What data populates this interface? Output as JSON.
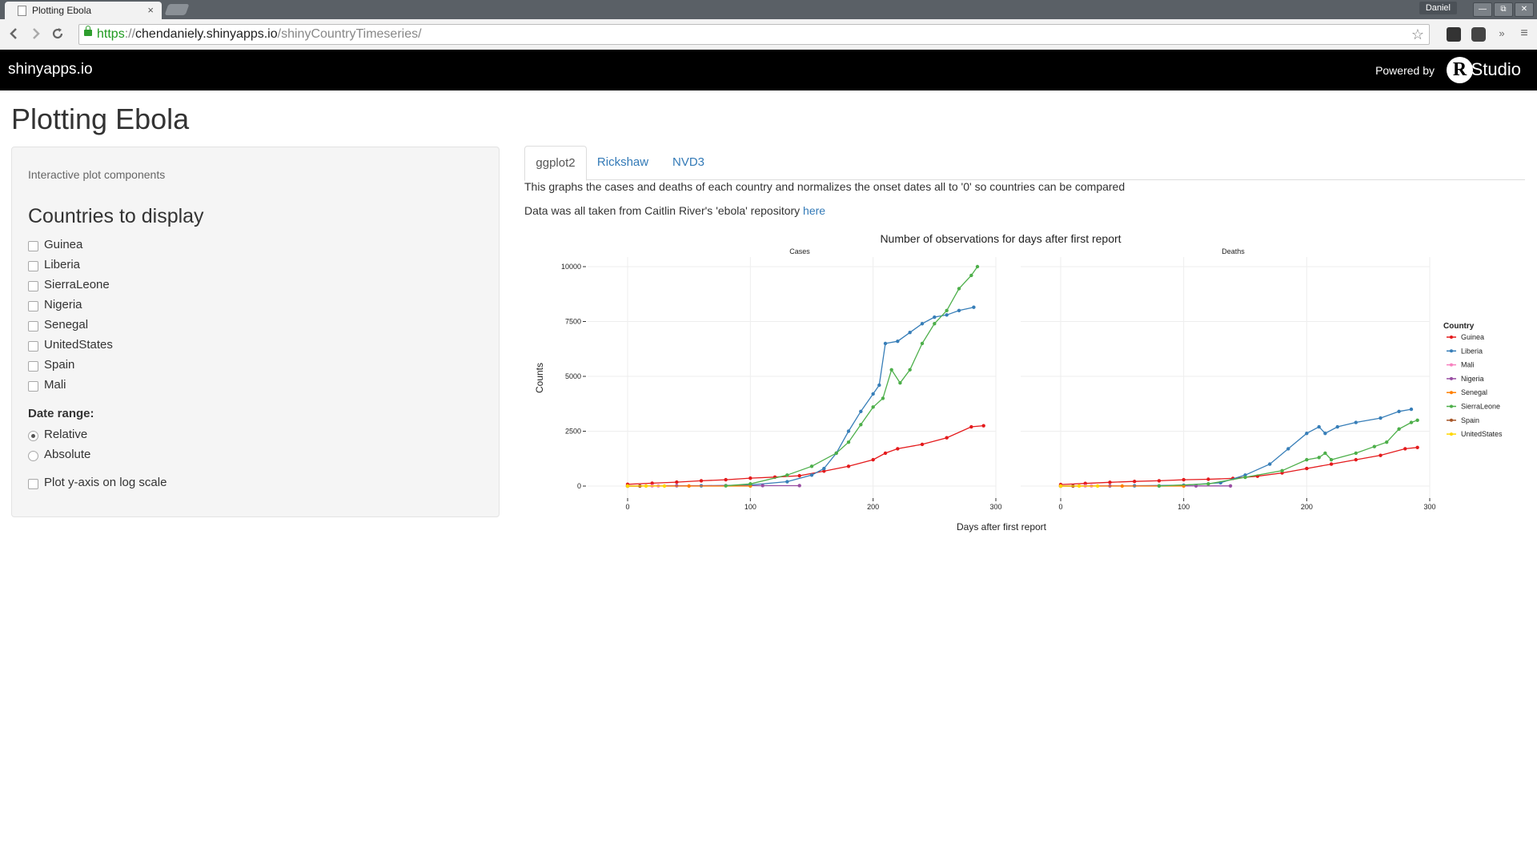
{
  "browser": {
    "tab_title": "Plotting Ebola",
    "tab_close": "×",
    "user": "Daniel",
    "url_scheme": "https",
    "url_sep": "://",
    "url_host": "chendaniely.shinyapps.io",
    "url_path": "/shinyCountryTimeseries/",
    "win_min": "—",
    "win_max": "⧉",
    "win_close": "✕"
  },
  "navbar": {
    "brand": "shinyapps.io",
    "powered_by": "Powered by",
    "rstudio_r": "R",
    "rstudio_text": "Studio"
  },
  "page": {
    "title": "Plotting Ebola"
  },
  "sidebar": {
    "caption": "Interactive plot components",
    "heading": "Countries to display",
    "countries": [
      {
        "label": "Guinea",
        "checked": false
      },
      {
        "label": "Liberia",
        "checked": false
      },
      {
        "label": "SierraLeone",
        "checked": false
      },
      {
        "label": "Nigeria",
        "checked": false
      },
      {
        "label": "Senegal",
        "checked": false
      },
      {
        "label": "UnitedStates",
        "checked": false
      },
      {
        "label": "Spain",
        "checked": false
      },
      {
        "label": "Mali",
        "checked": false
      }
    ],
    "date_range_label": "Date range:",
    "date_options": [
      {
        "label": "Relative",
        "selected": true
      },
      {
        "label": "Absolute",
        "selected": false
      }
    ],
    "log_scale_label": "Plot y-axis on log scale"
  },
  "tabs": [
    {
      "label": "ggplot2",
      "active": true
    },
    {
      "label": "Rickshaw",
      "active": false
    },
    {
      "label": "NVD3",
      "active": false
    }
  ],
  "description": {
    "line1": "This graphs the cases and deaths of each country and normalizes the onset dates all to '0' so countries can be compared",
    "line2_prefix": "Data was all taken from Caitlin River's 'ebola' repository",
    "line2_link": "here"
  },
  "chart_data": {
    "type": "line",
    "title": "Number of observations for days after first report",
    "xlabel": "Days after first report",
    "ylabel": "Counts",
    "xlim": [
      0,
      300
    ],
    "ylim": [
      0,
      10000
    ],
    "x_ticks": [
      0,
      100,
      200,
      300
    ],
    "y_ticks": [
      0,
      2500,
      5000,
      7500,
      10000
    ],
    "y_tick_labels": [
      "0",
      "2500",
      "5000",
      "7500",
      "10000"
    ],
    "grid": true,
    "legend_title": "Country",
    "legend_position": "right",
    "facets": [
      {
        "name": "Cases",
        "series": [
          {
            "name": "Guinea",
            "color": "#e41a1c",
            "points": [
              [
                0,
                80
              ],
              [
                20,
                130
              ],
              [
                40,
                180
              ],
              [
                60,
                240
              ],
              [
                80,
                290
              ],
              [
                100,
                360
              ],
              [
                120,
                410
              ],
              [
                140,
                470
              ],
              [
                160,
                680
              ],
              [
                180,
                900
              ],
              [
                200,
                1200
              ],
              [
                210,
                1500
              ],
              [
                220,
                1700
              ],
              [
                240,
                1900
              ],
              [
                260,
                2200
              ],
              [
                280,
                2700
              ],
              [
                290,
                2750
              ]
            ]
          },
          {
            "name": "Liberia",
            "color": "#377eb8",
            "points": [
              [
                60,
                10
              ],
              [
                100,
                50
              ],
              [
                130,
                200
              ],
              [
                150,
                500
              ],
              [
                160,
                800
              ],
              [
                170,
                1500
              ],
              [
                180,
                2500
              ],
              [
                190,
                3400
              ],
              [
                200,
                4200
              ],
              [
                205,
                4600
              ],
              [
                210,
                6500
              ],
              [
                220,
                6600
              ],
              [
                230,
                7000
              ],
              [
                240,
                7400
              ],
              [
                250,
                7700
              ],
              [
                260,
                7800
              ],
              [
                270,
                8000
              ],
              [
                282,
                8150
              ]
            ]
          },
          {
            "name": "Mali",
            "color": "#f781bf",
            "points": [
              [
                0,
                1
              ],
              [
                10,
                3
              ],
              [
                20,
                6
              ],
              [
                25,
                8
              ]
            ]
          },
          {
            "name": "Nigeria",
            "color": "#984ea3",
            "points": [
              [
                0,
                0
              ],
              [
                40,
                15
              ],
              [
                80,
                20
              ],
              [
                110,
                20
              ],
              [
                140,
                20
              ]
            ]
          },
          {
            "name": "Senegal",
            "color": "#ff7f00",
            "points": [
              [
                0,
                1
              ],
              [
                50,
                1
              ],
              [
                100,
                1
              ]
            ]
          },
          {
            "name": "SierraLeone",
            "color": "#4daf4a",
            "points": [
              [
                80,
                10
              ],
              [
                100,
                100
              ],
              [
                130,
                500
              ],
              [
                150,
                900
              ],
              [
                170,
                1500
              ],
              [
                180,
                2000
              ],
              [
                190,
                2800
              ],
              [
                200,
                3600
              ],
              [
                208,
                4000
              ],
              [
                215,
                5300
              ],
              [
                222,
                4700
              ],
              [
                230,
                5300
              ],
              [
                240,
                6500
              ],
              [
                250,
                7400
              ],
              [
                260,
                8000
              ],
              [
                270,
                9000
              ],
              [
                280,
                9600
              ],
              [
                285,
                10000
              ]
            ]
          },
          {
            "name": "Spain",
            "color": "#a65628",
            "points": [
              [
                0,
                1
              ],
              [
                10,
                1
              ]
            ]
          },
          {
            "name": "UnitedStates",
            "color": "#ffd700",
            "points": [
              [
                0,
                1
              ],
              [
                15,
                4
              ],
              [
                30,
                4
              ]
            ]
          }
        ]
      },
      {
        "name": "Deaths",
        "series": [
          {
            "name": "Guinea",
            "color": "#e41a1c",
            "points": [
              [
                0,
                70
              ],
              [
                20,
                120
              ],
              [
                40,
                170
              ],
              [
                60,
                210
              ],
              [
                80,
                240
              ],
              [
                100,
                290
              ],
              [
                120,
                310
              ],
              [
                140,
                350
              ],
              [
                160,
                450
              ],
              [
                180,
                600
              ],
              [
                200,
                800
              ],
              [
                220,
                1000
              ],
              [
                240,
                1200
              ],
              [
                260,
                1400
              ],
              [
                280,
                1700
              ],
              [
                290,
                1760
              ]
            ]
          },
          {
            "name": "Liberia",
            "color": "#377eb8",
            "points": [
              [
                60,
                10
              ],
              [
                100,
                40
              ],
              [
                130,
                150
              ],
              [
                150,
                500
              ],
              [
                170,
                1000
              ],
              [
                185,
                1700
              ],
              [
                200,
                2400
              ],
              [
                210,
                2700
              ],
              [
                215,
                2400
              ],
              [
                225,
                2700
              ],
              [
                240,
                2900
              ],
              [
                260,
                3100
              ],
              [
                275,
                3400
              ],
              [
                285,
                3500
              ]
            ]
          },
          {
            "name": "Mali",
            "color": "#f781bf",
            "points": [
              [
                0,
                1
              ],
              [
                10,
                3
              ],
              [
                20,
                6
              ],
              [
                25,
                6
              ]
            ]
          },
          {
            "name": "Nigeria",
            "color": "#984ea3",
            "points": [
              [
                0,
                0
              ],
              [
                40,
                8
              ],
              [
                80,
                8
              ],
              [
                110,
                8
              ],
              [
                138,
                8
              ]
            ]
          },
          {
            "name": "Senegal",
            "color": "#ff7f00",
            "points": [
              [
                0,
                0
              ],
              [
                50,
                0
              ],
              [
                100,
                0
              ]
            ]
          },
          {
            "name": "SierraLeone",
            "color": "#4daf4a",
            "points": [
              [
                80,
                5
              ],
              [
                120,
                100
              ],
              [
                150,
                400
              ],
              [
                180,
                700
              ],
              [
                200,
                1200
              ],
              [
                210,
                1300
              ],
              [
                215,
                1500
              ],
              [
                220,
                1200
              ],
              [
                240,
                1500
              ],
              [
                255,
                1800
              ],
              [
                265,
                2000
              ],
              [
                275,
                2600
              ],
              [
                285,
                2900
              ],
              [
                290,
                3000
              ]
            ]
          },
          {
            "name": "Spain",
            "color": "#a65628",
            "points": [
              [
                0,
                1
              ],
              [
                10,
                1
              ]
            ]
          },
          {
            "name": "UnitedStates",
            "color": "#ffd700",
            "points": [
              [
                0,
                1
              ],
              [
                15,
                1
              ],
              [
                30,
                1
              ]
            ]
          }
        ]
      }
    ]
  }
}
